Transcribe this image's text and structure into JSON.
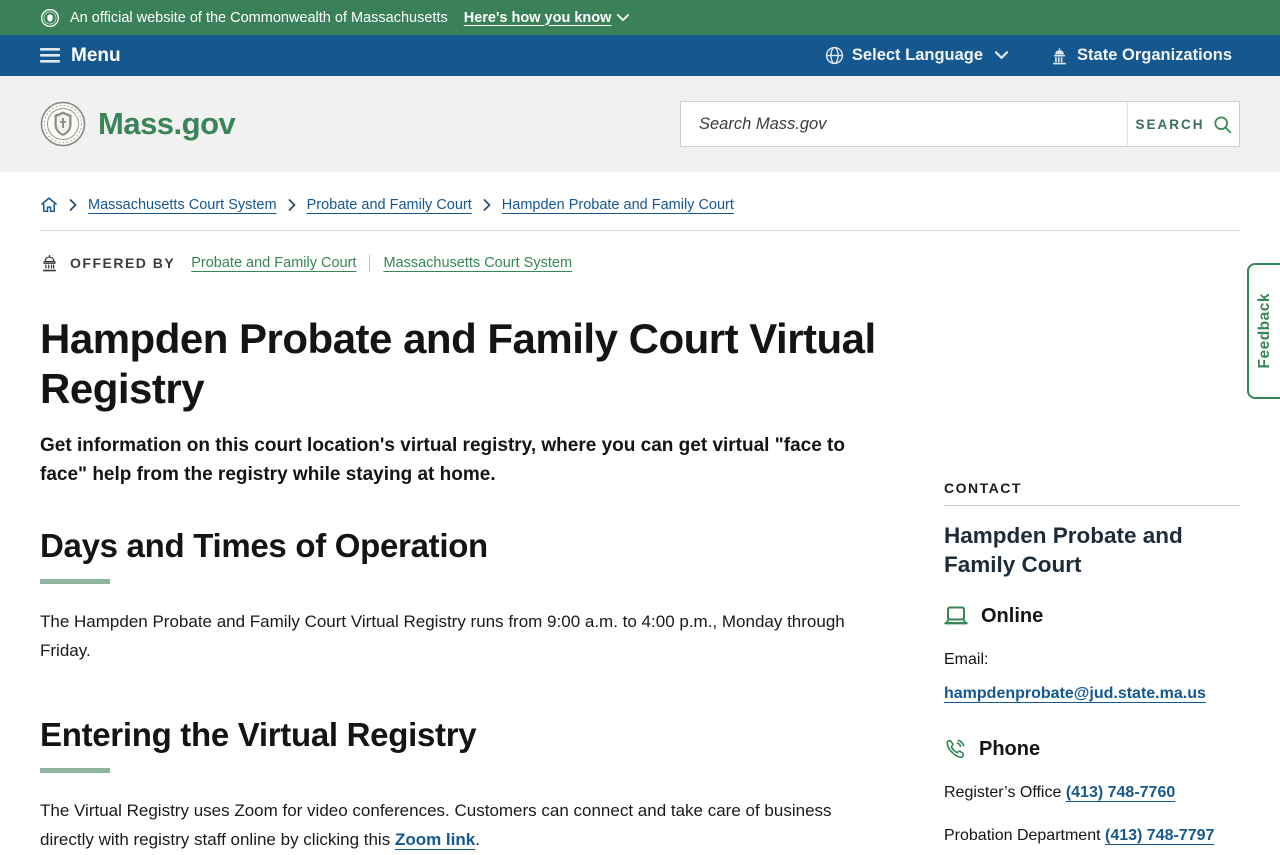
{
  "colors": {
    "brand_green": "#3a8159",
    "brand_blue": "#15578f",
    "link_blue": "#15578f",
    "accent_sage": "#8fb5a0"
  },
  "banner": {
    "text": "An official website of the Commonwealth of Massachusetts",
    "disclosure_link": "Here's how you know"
  },
  "navbar": {
    "menu_label": "Menu",
    "language_label": "Select Language",
    "state_orgs_label": "State Organizations"
  },
  "header": {
    "logo_text": "Mass.gov",
    "search_placeholder": "Search Mass.gov",
    "search_button_label": "SEARCH"
  },
  "breadcrumb": {
    "items": [
      {
        "label": "Massachusetts Court System"
      },
      {
        "label": "Probate and Family Court"
      },
      {
        "label": "Hampden Probate and Family Court"
      }
    ]
  },
  "offered_by": {
    "label": "OFFERED BY",
    "links": [
      {
        "label": "Probate and Family Court"
      },
      {
        "label": "Massachusetts Court System"
      }
    ]
  },
  "page": {
    "title": "Hampden Probate and Family Court Virtual Registry",
    "subtitle": "Get information on this court location's virtual registry, where you can get virtual \"face to face\" help from the registry while staying at home."
  },
  "sections": [
    {
      "heading": "Days and Times of Operation",
      "body": "The Hampden Probate and Family Court Virtual Registry runs from 9:00 a.m. to 4:00 p.m., Monday through Friday."
    },
    {
      "heading": "Entering the Virtual Registry",
      "body_before_link": "The Virtual Registry uses Zoom for video conferences. Customers can connect and take care of  business directly with registry staff online by clicking this ",
      "link_text": "Zoom link",
      "body_after_link": "."
    }
  ],
  "sidebar": {
    "contact_label": "CONTACT",
    "org_name": "Hampden Probate and Family Court",
    "online": {
      "heading": "Online",
      "email_label": "Email:",
      "email_link": "hampdenprobate@jud.state.ma.us"
    },
    "phone": {
      "heading": "Phone",
      "rows": [
        {
          "label": "Register’s Office ",
          "number": "(413) 748-7760"
        },
        {
          "label": "Probation Department ",
          "number": "(413) 748-7797"
        }
      ]
    }
  },
  "feedback": {
    "label": "Feedback"
  }
}
